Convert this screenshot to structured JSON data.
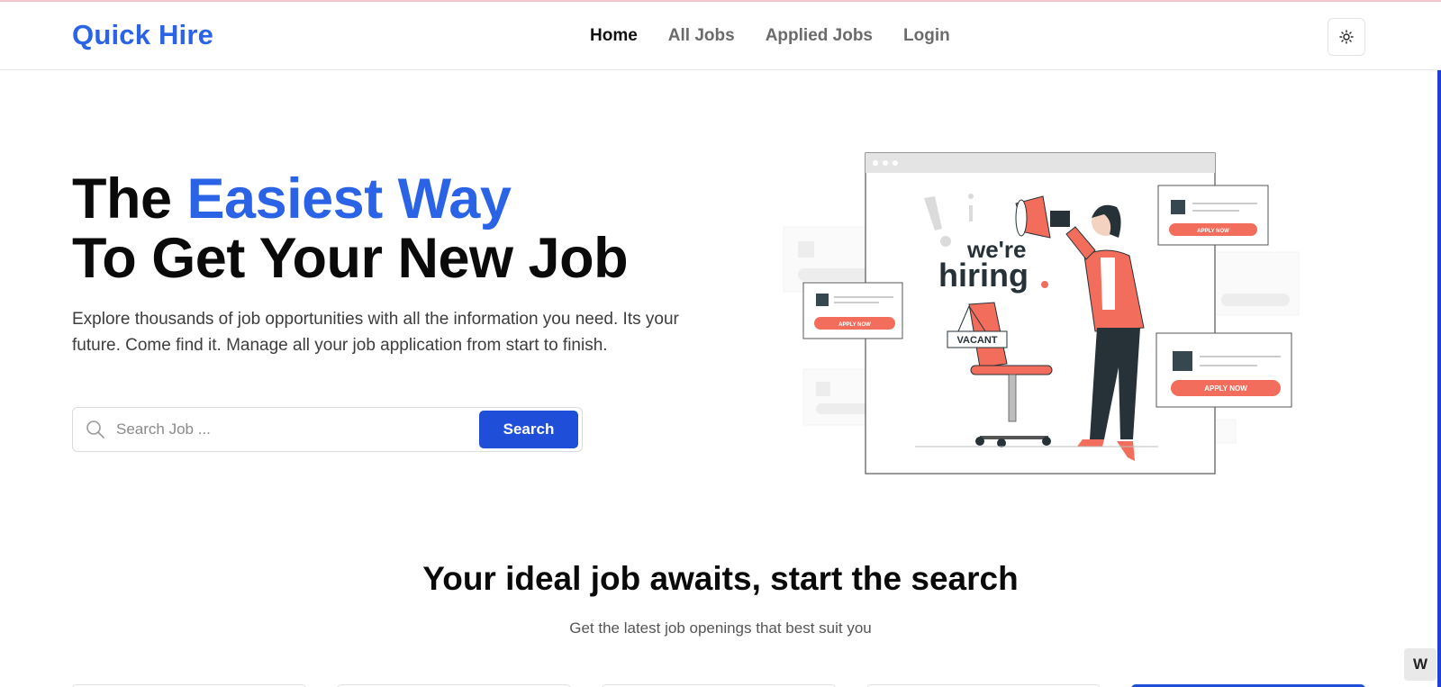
{
  "header": {
    "logo": "Quick Hire",
    "nav": [
      {
        "label": "Home",
        "active": true
      },
      {
        "label": "All Jobs",
        "active": false
      },
      {
        "label": "Applied Jobs",
        "active": false
      },
      {
        "label": "Login",
        "active": false
      }
    ],
    "theme_toggle_icon": "sun-icon"
  },
  "hero": {
    "title_part1": "The ",
    "title_highlight": "Easiest Way",
    "title_line2": "To Get Your New Job",
    "subtitle": "Explore thousands of job opportunities with all the information you need. Its your future. Come find it. Manage all your job application from start to finish.",
    "search": {
      "placeholder": "Search Job ...",
      "value": "",
      "button_label": "Search"
    },
    "illustration": {
      "headline_line1": "we're",
      "headline_line2": "hiring",
      "sign": "VACANT",
      "card_button": "APPLY NOW"
    }
  },
  "section": {
    "title": "Your ideal job awaits, start the search",
    "subtitle": "Get the latest job openings that best suit you"
  },
  "corner_badge": "W",
  "colors": {
    "brand_blue": "#2b63e6",
    "button_blue": "#1f4fd8",
    "accent_coral": "#f26d5b"
  }
}
